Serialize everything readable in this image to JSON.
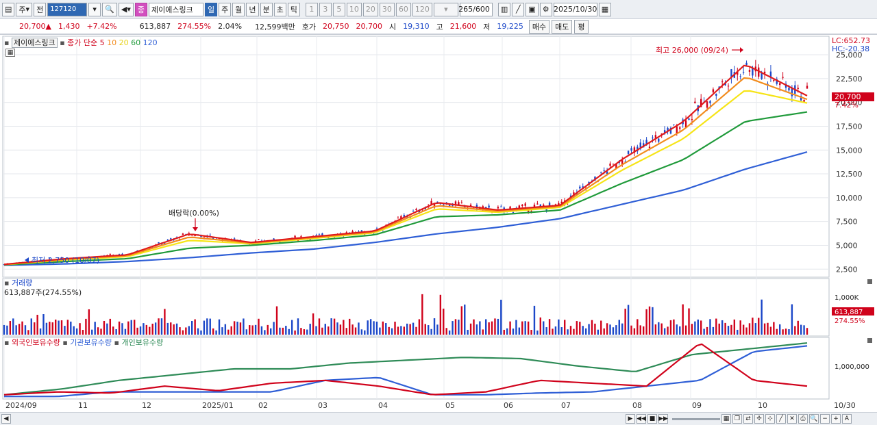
{
  "toolbar": {
    "period_btn": "주",
    "prev_label": "전",
    "stock_code": "127120",
    "badge_label": "종",
    "stock_name": "제이에스링크",
    "interval_tabs": [
      "일",
      "주",
      "월",
      "년",
      "분",
      "초",
      "틱"
    ],
    "interval_selected": "일",
    "minute_btns": [
      "1",
      "3",
      "5",
      "10",
      "20",
      "30",
      "60",
      "120"
    ],
    "count_display": "265/600",
    "date_value": "2025/10/30"
  },
  "quote": {
    "price": "20,700▲",
    "change": "1,430",
    "change_pct": "+7.42%",
    "volume": "613,887",
    "volume_ratio": "274.55%",
    "turnover_rate": "2.04%",
    "trade_value": "12,599백만",
    "ask_label": "호가",
    "ask_price": "20,750",
    "bid_price": "20,700",
    "open_label": "시",
    "open": "19,310",
    "high_label": "고",
    "high": "21,600",
    "low_label": "저",
    "low": "19,225",
    "buy_btn": "매수",
    "sell_btn": "매도",
    "eval_btn": "평"
  },
  "price_panel": {
    "stock_name": "제이에스링크",
    "ma_label": "종가 단순",
    "ma_periods": [
      "5",
      "10",
      "20",
      "60",
      "120"
    ],
    "lc": "LC:652.73",
    "hc": "HC:-20.38",
    "last_price": "20,700",
    "last_change": "7.42%",
    "annot_high": "최고 26,000 (09/24)",
    "annot_low": "최저 2,750 (10/07)",
    "annot_div": "배당락(0.00%)",
    "y_ticks": [
      "25,000",
      "22,500",
      "20,000",
      "17,500",
      "15,000",
      "12,500",
      "10,000",
      "7,500",
      "5,000",
      "2,500"
    ]
  },
  "volume_panel": {
    "title": "거래량",
    "summary": "613,887주(274.55%)",
    "y_tick": "1,000K",
    "last_volume": "613,887",
    "last_ratio": "274.55%"
  },
  "holdings_panel": {
    "legend": [
      "외국인보유수량",
      "기관보유수량",
      "개인보유수량"
    ],
    "y_tick": "1,000,000"
  },
  "x_axis": [
    "2024/09",
    "11",
    "12",
    "2025/01",
    "02",
    "03",
    "04",
    "05",
    "06",
    "07",
    "08",
    "09",
    "10",
    "10/30"
  ],
  "colors": {
    "up": "#d0021b",
    "down": "#1b47c8",
    "ma5": "#e01b1b",
    "ma10": "#f28c1e",
    "ma20": "#f6e416",
    "ma60": "#1f9a3a",
    "ma120": "#2f5fd6",
    "foreign": "#d0021b",
    "inst": "#2f5fd6",
    "retail": "#2e8b57"
  },
  "chart_data": {
    "type": "line",
    "title": "제이에스링크",
    "x": [
      "2024/09",
      "11",
      "12",
      "2025/01",
      "02",
      "03",
      "04",
      "05",
      "06",
      "07",
      "08",
      "09",
      "10",
      "10/30"
    ],
    "series": [
      {
        "name": "5",
        "values": [
          3000,
          3600,
          4000,
          6200,
          5300,
          5900,
          6500,
          9500,
          8700,
          9200,
          14000,
          18000,
          24000,
          20700
        ]
      },
      {
        "name": "60",
        "values": [
          2950,
          3300,
          3600,
          4700,
          5000,
          5500,
          6100,
          8000,
          8200,
          8700,
          11500,
          14000,
          18000,
          19000
        ]
      },
      {
        "name": "120",
        "values": [
          2900,
          3050,
          3300,
          3700,
          4200,
          4600,
          5300,
          6200,
          6900,
          7800,
          9300,
          10800,
          13000,
          14800
        ]
      }
    ],
    "ylim": [
      2500,
      26000
    ]
  }
}
